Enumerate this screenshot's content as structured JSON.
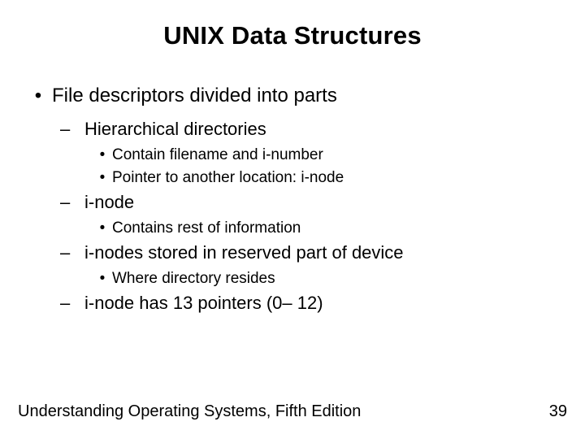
{
  "title": "UNIX Data Structures",
  "bullets": {
    "l1_1": "File descriptors divided into parts",
    "l2_1": "Hierarchical directories",
    "l3_1": "Contain filename and i-number",
    "l3_2": "Pointer to another location: i-node",
    "l2_2": "i-node",
    "l3_3": "Contains rest of information",
    "l2_3": "i-nodes stored in reserved part of device",
    "l3_4": "Where directory resides",
    "l2_4": "i-node has 13 pointers (0– 12)"
  },
  "footer": {
    "left": "Understanding Operating Systems, Fifth Edition",
    "right": "39"
  },
  "glyphs": {
    "dot": "•",
    "dash": "–"
  }
}
